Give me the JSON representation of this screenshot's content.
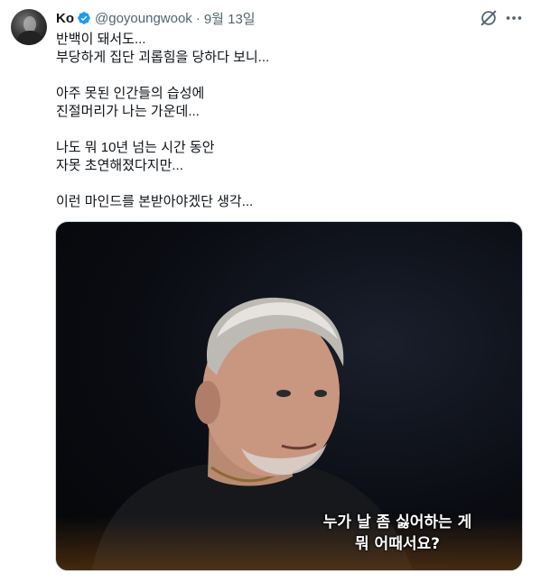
{
  "tweet": {
    "author_name": "Ko",
    "handle": "@goyoungwook",
    "separator": "·",
    "date": "9월 13일",
    "lines": [
      "반백이 돼서도...",
      "부당하게 집단 괴롭힘을 당하다 보니...",
      "",
      "아주 못된 인간들의 습성에",
      "진절머리가 나는 가운데...",
      "",
      "나도 뭐 10년 넘는 시간 동안",
      "자못 초연해졌다지만...",
      "",
      "이런 마인드를 본받아야겠단 생각..."
    ]
  },
  "media": {
    "subtitle_line1": "누가 날 좀 싫어하는 게",
    "subtitle_line2": "뭐 어때서요?"
  },
  "icons": {
    "verified": "verified-badge-icon",
    "grok": "grok-icon",
    "more": "more-options-icon"
  },
  "colors": {
    "verified": "#1d9bf0",
    "text_primary": "#0f1419",
    "text_secondary": "#536471"
  }
}
